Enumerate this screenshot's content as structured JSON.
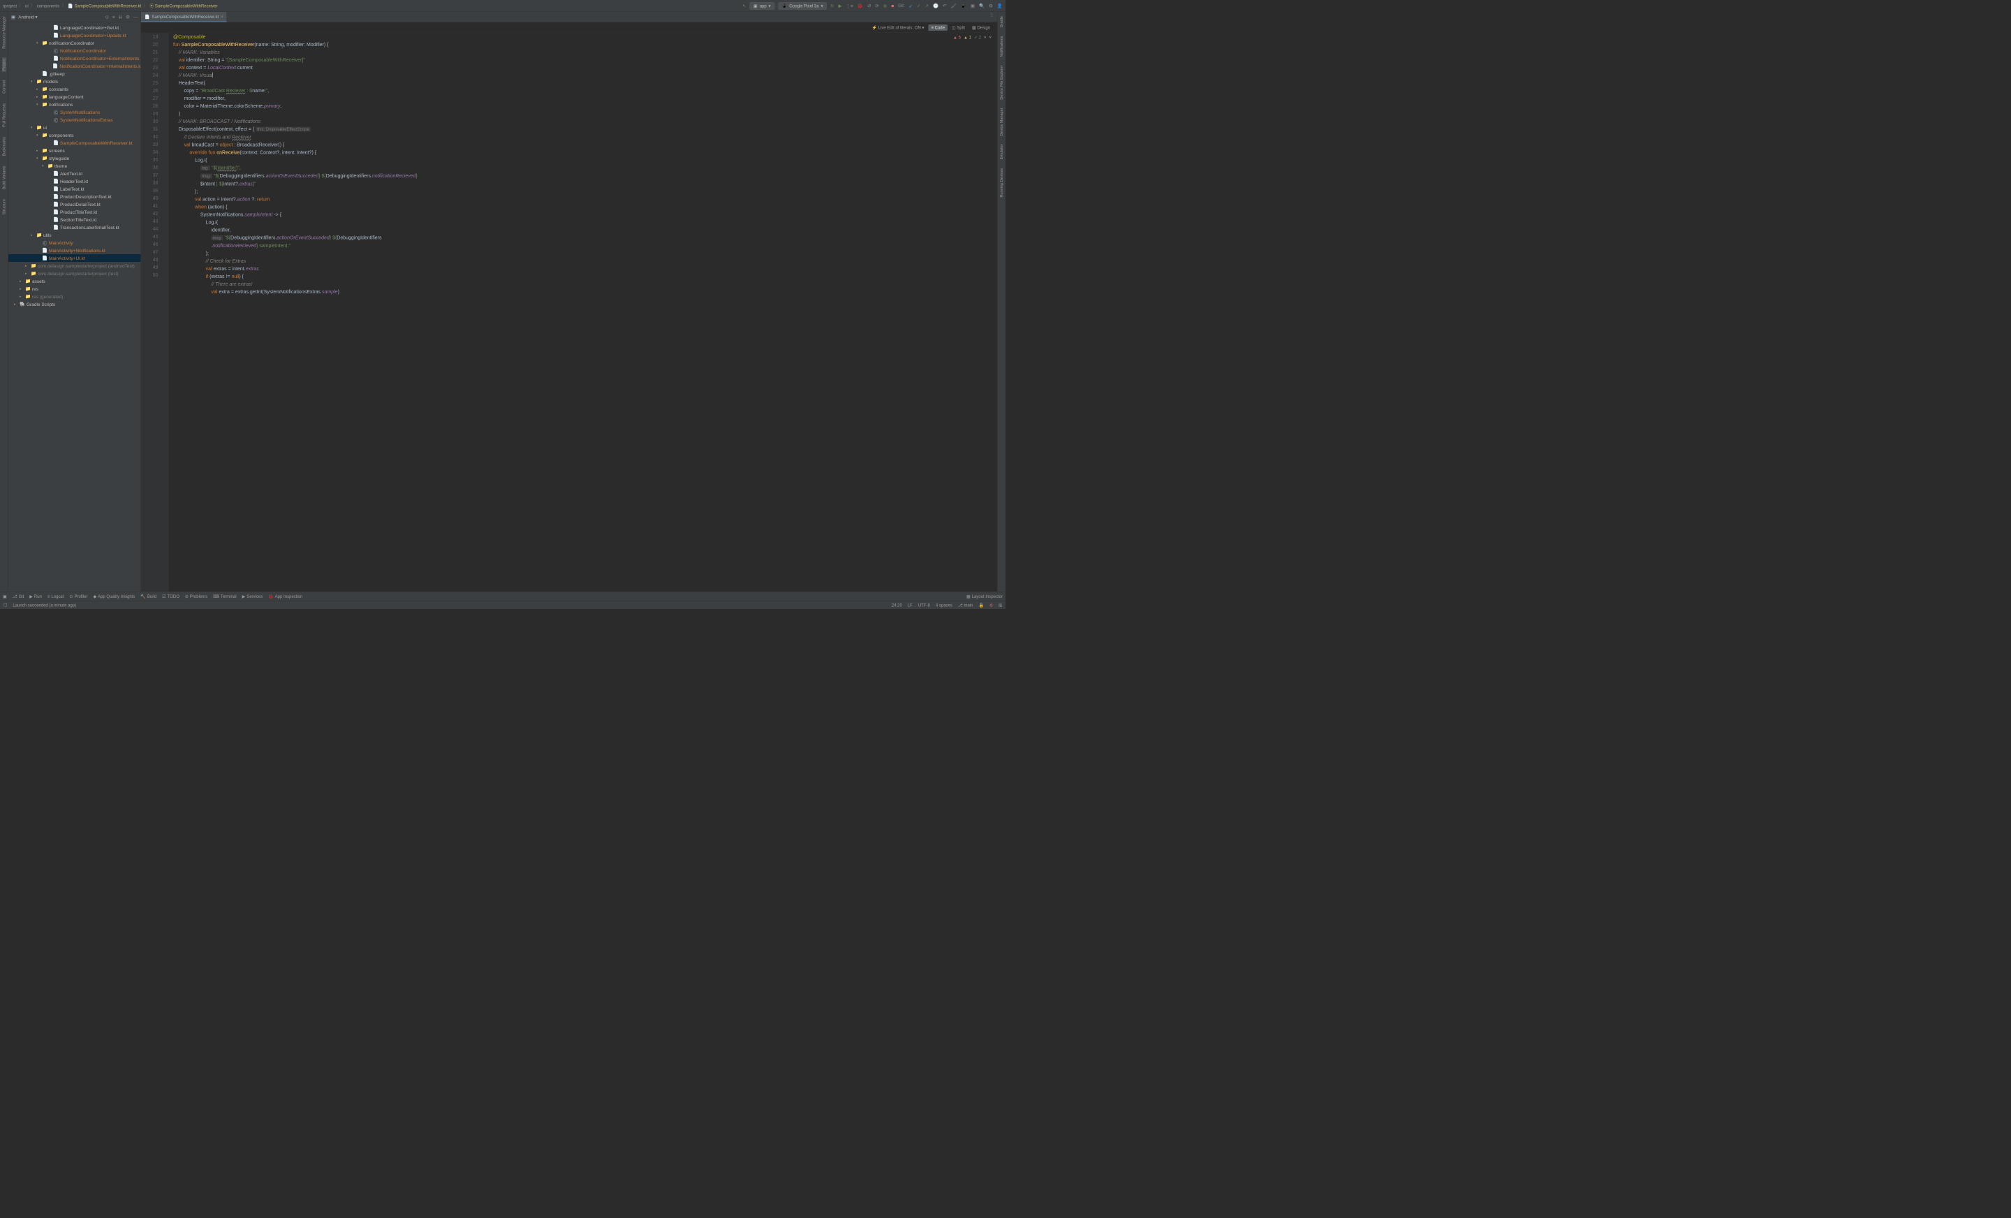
{
  "breadcrumb": {
    "parts": [
      "rproject",
      "ui",
      "components",
      "SampleComposableWithReceiver.kt",
      "SampleComposableWithReceiver"
    ]
  },
  "toolbar": {
    "run_config": "app",
    "device": "Google Pixel 3a",
    "git_label": "Git:"
  },
  "left_rail": {
    "items": [
      "Resource Manager",
      "Project",
      "Commit",
      "Pull Requests",
      "Bookmarks",
      "Build Variants",
      "Structure"
    ]
  },
  "project_panel": {
    "title": "Android",
    "tree": [
      {
        "indent": 7,
        "icon": "kt",
        "label": "LanguageCoordinator+Get.kt",
        "cls": ""
      },
      {
        "indent": 7,
        "icon": "kt",
        "label": "LanguageCoordinator+Update.kt",
        "cls": "warn"
      },
      {
        "indent": 5,
        "arrow": "▾",
        "icon": "folder",
        "label": "notificationCoordinator",
        "cls": ""
      },
      {
        "indent": 7,
        "icon": "cls",
        "label": "NotificationCoordinator",
        "cls": "warn"
      },
      {
        "indent": 7,
        "icon": "kt",
        "label": "NotificationCoordinator+ExternalIntents.",
        "cls": "warn"
      },
      {
        "indent": 7,
        "icon": "kt",
        "label": "NotificationCoordinator+InternalIntents.k",
        "cls": "warn"
      },
      {
        "indent": 5,
        "icon": "file",
        "label": ".gitkeep",
        "cls": ""
      },
      {
        "indent": 4,
        "arrow": "▾",
        "icon": "folder",
        "label": "models",
        "cls": ""
      },
      {
        "indent": 5,
        "arrow": "▸",
        "icon": "folder",
        "label": "constants",
        "cls": ""
      },
      {
        "indent": 5,
        "arrow": "▸",
        "icon": "folder",
        "label": "languageContent",
        "cls": ""
      },
      {
        "indent": 5,
        "arrow": "▾",
        "icon": "folder",
        "label": "notifications",
        "cls": ""
      },
      {
        "indent": 7,
        "icon": "cls",
        "label": "SystemNotifications",
        "cls": "warn"
      },
      {
        "indent": 7,
        "icon": "cls",
        "label": "SystemNotificationsExtras",
        "cls": "warn"
      },
      {
        "indent": 4,
        "arrow": "▾",
        "icon": "folder",
        "label": "ui",
        "cls": ""
      },
      {
        "indent": 5,
        "arrow": "▾",
        "icon": "folder",
        "label": "components",
        "cls": ""
      },
      {
        "indent": 7,
        "icon": "kt",
        "label": "SampleComposableWithReceiver.kt",
        "cls": "warn"
      },
      {
        "indent": 5,
        "arrow": "▸",
        "icon": "folder",
        "label": "screens",
        "cls": ""
      },
      {
        "indent": 5,
        "arrow": "▾",
        "icon": "folder",
        "label": "styleguide",
        "cls": ""
      },
      {
        "indent": 6,
        "arrow": "▾",
        "icon": "folder",
        "label": "theme",
        "cls": ""
      },
      {
        "indent": 7,
        "icon": "kt",
        "label": "AlertText.kt",
        "cls": ""
      },
      {
        "indent": 7,
        "icon": "kt",
        "label": "HeaderText.kt",
        "cls": ""
      },
      {
        "indent": 7,
        "icon": "kt",
        "label": "LabelText.kt",
        "cls": ""
      },
      {
        "indent": 7,
        "icon": "kt",
        "label": "ProductDescriptionText.kt",
        "cls": ""
      },
      {
        "indent": 7,
        "icon": "kt",
        "label": "ProductDetailText.kt",
        "cls": ""
      },
      {
        "indent": 7,
        "icon": "kt",
        "label": "ProductTitleText.kt",
        "cls": ""
      },
      {
        "indent": 7,
        "icon": "kt",
        "label": "SectionTitleText.kt",
        "cls": ""
      },
      {
        "indent": 7,
        "icon": "kt",
        "label": "TransactionLabelSmallText.kt",
        "cls": ""
      },
      {
        "indent": 4,
        "arrow": "▸",
        "icon": "folder",
        "label": "utils",
        "cls": ""
      },
      {
        "indent": 5,
        "icon": "cls",
        "label": "MainActivity",
        "cls": "warn"
      },
      {
        "indent": 5,
        "icon": "kt",
        "label": "MainActivity+Notifications.kt",
        "cls": "warn"
      },
      {
        "indent": 5,
        "icon": "kt",
        "label": "MainActivity+UI.kt",
        "cls": "warn",
        "selected": true
      },
      {
        "indent": 3,
        "arrow": "▸",
        "icon": "folder",
        "label": "com.delasign.samplestarterproject (androidTest)",
        "cls": "grey"
      },
      {
        "indent": 3,
        "arrow": "▸",
        "icon": "folder",
        "label": "com.delasign.samplestarterproject (test)",
        "cls": "grey"
      },
      {
        "indent": 2,
        "arrow": "▸",
        "icon": "folder",
        "label": "assets",
        "cls": ""
      },
      {
        "indent": 2,
        "arrow": "▸",
        "icon": "folder",
        "label": "res",
        "cls": ""
      },
      {
        "indent": 2,
        "arrow": "▸",
        "icon": "folder",
        "label": "res (generated)",
        "cls": "grey"
      },
      {
        "indent": 1,
        "arrow": "▸",
        "icon": "gradle",
        "label": "Gradle Scripts",
        "cls": ""
      }
    ]
  },
  "editor": {
    "tab_name": "SampleComposableWithReceiver.kt",
    "live_edit": "Live Edit of literals: ON",
    "view_code": "Code",
    "view_split": "Split",
    "view_design": "Design",
    "problems": {
      "errors": "5",
      "warnings": "1",
      "ok": "2"
    },
    "line_start": 19,
    "lines": [
      {
        "n": 19,
        "html": "<span class='ann'>@Composable</span>"
      },
      {
        "n": 20,
        "html": "<span class='kw'>fun</span> <span class='fn'>SampleComposableWithReceiver</span>(name: String, modifier: Modifier) {"
      },
      {
        "n": 21,
        "html": "    <span class='com'>// MARK: Variables</span>"
      },
      {
        "n": 22,
        "html": "    <span class='kw'>val</span> identifier: String = <span class='str'>\"[SampleComposableWithReceiver]\"</span>"
      },
      {
        "n": 23,
        "html": "    <span class='kw'>val</span> context = <span class='prop'>LocalContext</span>.current"
      },
      {
        "n": 24,
        "html": "    <span class='com'>// MARK: Visual</span><span class='caret'></span>"
      },
      {
        "n": 25,
        "html": "    HeaderText("
      },
      {
        "n": 26,
        "html": "        copy = <span class='str'>\"BroadCast <span class='err-underline'>Reciever</span> : $</span>name<span class='str'>!\"</span>,"
      },
      {
        "n": 27,
        "html": "        modifier = modifier,"
      },
      {
        "n": 28,
        "html": "        color = MaterialTheme.colorScheme.<span class='prop'>primary</span>,"
      },
      {
        "n": 29,
        "html": "    )"
      },
      {
        "n": 30,
        "html": "    <span class='com'>// MARK: BROADCAST / Notifications</span>"
      },
      {
        "n": 31,
        "html": "    DisposableEffect(context, effect = { <span class='hint'>this: DisposableEffectScope</span>"
      },
      {
        "n": 32,
        "html": "        <span class='com'>// Declare Intents and <span class='err-underline'>Reciever</span></span>"
      },
      {
        "n": 33,
        "html": "        <span class='kw'>val</span> broadCast = <span class='kw'>object</span> : BroadcastReceiver() {"
      },
      {
        "n": 34,
        "html": "            <span class='kw'>override fun</span> <span class='fn'>onReceive</span>(context: Context?, intent: Intent?) {"
      },
      {
        "n": 35,
        "html": "                Log.i("
      },
      {
        "n": 36,
        "html": "                    <span class='hint'>tag:</span> <span class='str'>\"${<span class='err-underline'>identifier</span>}\"</span>,"
      },
      {
        "n": 37,
        "html": "                    <span class='hint'>msg:</span> <span class='str'>\"${</span>DebuggingIdentifiers.<span class='prop'>actionOrEventSucceded</span><span class='str'>} ${</span>DebuggingIdentifiers.<span class='prop'>notificationRecieved</span><span class='str'>}"
      },
      {
        "n": "",
        "html": "                    $</span>intent<span class='str'> | ${</span>intent?.<span class='prop'>extras</span><span class='str'>}\"</span>"
      },
      {
        "n": 38,
        "html": "                );"
      },
      {
        "n": 39,
        "html": "                <span class='kw'>val</span> action = intent?.<span class='prop'>action</span> ?: <span class='kw'>return</span>"
      },
      {
        "n": 40,
        "html": "                <span class='kw'>when</span> (action) {"
      },
      {
        "n": 41,
        "html": "                    SystemNotifications.<span class='prop'>sampleIntent</span> -> {"
      },
      {
        "n": 42,
        "html": "                        Log.i("
      },
      {
        "n": 43,
        "html": "                            identifier,"
      },
      {
        "n": 44,
        "html": "                            <span class='hint'>msg:</span> <span class='str'>\"${</span>DebuggingIdentifiers.<span class='prop'>actionOrEventSucceded</span><span class='str'>} ${</span>DebuggingIdentifiers"
      },
      {
        "n": "",
        "html": "                            .<span class='prop'>notificationRecieved</span><span class='str'>} sampleIntent.\"</span>"
      },
      {
        "n": 45,
        "html": "                        );"
      },
      {
        "n": 46,
        "html": "                        <span class='com'>// Check for Extras</span>"
      },
      {
        "n": 47,
        "html": "                        <span class='kw'>val</span> extras = intent.<span class='prop'>extras</span>"
      },
      {
        "n": 48,
        "html": "                        <span class='kw'>if</span> (extras != <span class='kw'>null</span>) {"
      },
      {
        "n": 49,
        "html": "                            <span class='com'>// There are extras!</span>"
      },
      {
        "n": 50,
        "html": "                            <span class='kw'>val</span> extra = extras.getInt(SystemNotificationsExtras.<span class='prop'>sample</span>)"
      }
    ]
  },
  "right_rail": {
    "items": [
      "Gradle",
      "Notifications",
      "Device File Explorer",
      "Device Manager",
      "Emulator",
      "Running Devices"
    ]
  },
  "bottom_toolbar": {
    "items": [
      "Git",
      "Run",
      "Logcat",
      "Profiler",
      "App Quality Insights",
      "Build",
      "TODO",
      "Problems",
      "Terminal",
      "Services",
      "App Inspection"
    ],
    "right": "Layout Inspector"
  },
  "status_bar": {
    "message": "Launch succeeded (a minute ago)",
    "cursor": "24:20",
    "line_ending": "LF",
    "encoding": "UTF-8",
    "indent": "4 spaces",
    "branch": "main"
  }
}
